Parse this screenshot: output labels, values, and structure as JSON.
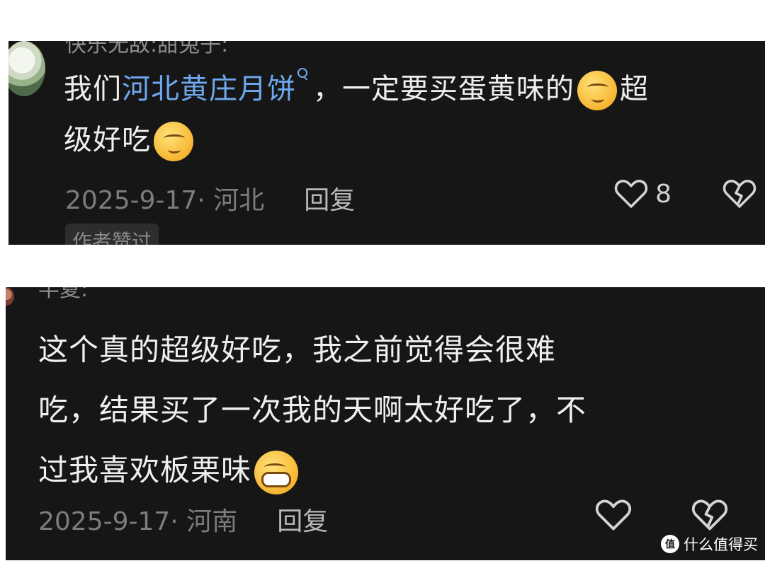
{
  "comment1": {
    "username": "快乐无敌:甜兔子:",
    "content_before": "我们",
    "link_text": "河北黄庄月饼",
    "content_mid": "，一定要买蛋黄味的",
    "content_mid2": "超",
    "content_after": "级好吃",
    "emoji": "thinking-face-emoji",
    "date_location": "2025-9-17· 河北",
    "reply_label": "回复",
    "like_count": "8",
    "badge": "作者赞过"
  },
  "comment2": {
    "username": "半夏:",
    "content_line1": "这个真的超级好吃，我之前觉得会很难",
    "content_line2": "吃，结果买了一次我的天啊太好吃了，不",
    "content_line3": "过我喜欢板栗味",
    "emoji": "grinning-face-emoji",
    "date_location": "2025-9-17· 河南",
    "reply_label": "回复"
  },
  "watermark": {
    "logo": "值",
    "text": "什么值得买"
  }
}
